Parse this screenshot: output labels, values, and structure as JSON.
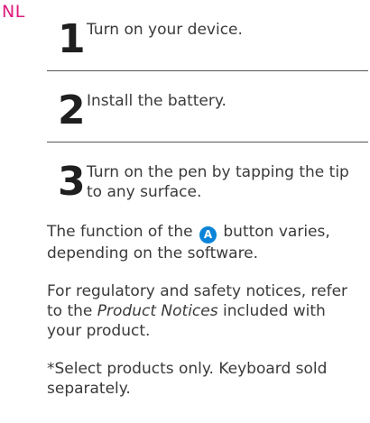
{
  "language_code": "NL",
  "steps": [
    {
      "number": "1",
      "text": "Turn on your device."
    },
    {
      "number": "2",
      "text": "Install the battery."
    },
    {
      "number": "3",
      "text": "Turn on the pen by tapping the tip to any surface."
    }
  ],
  "function_note": {
    "before": "The function of the ",
    "badge": "A",
    "after": " button varies, depending on the software."
  },
  "regulatory_note": {
    "before": "For regulatory and safety notices, refer to the ",
    "doc_title": "Product Notices",
    "after": " included with your product."
  },
  "footnote": "*Select products only. Keyboard sold separately.",
  "colors": {
    "language_tag": "#e0197d",
    "badge": "#0a84d8"
  }
}
